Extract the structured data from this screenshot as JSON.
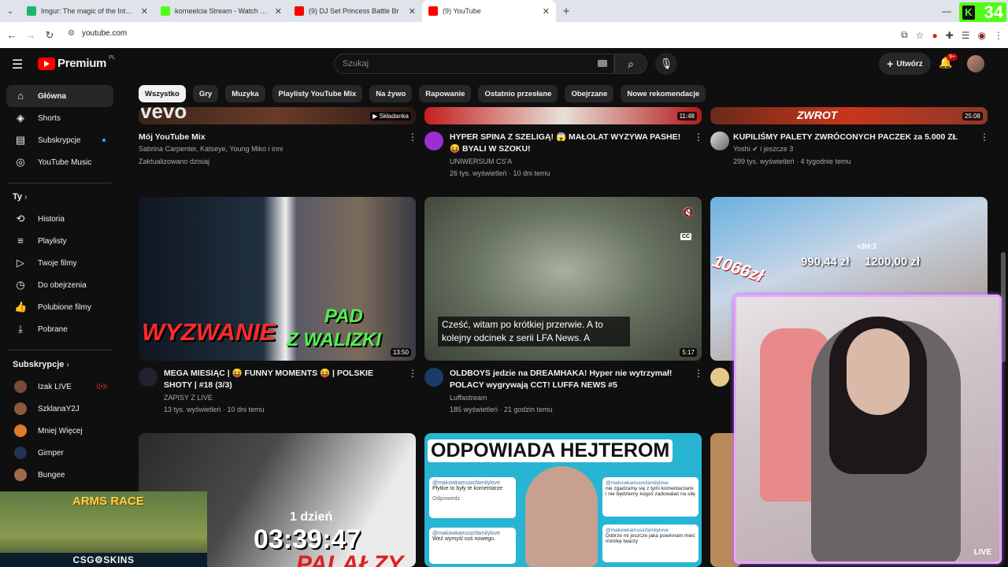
{
  "browser": {
    "tabs": [
      {
        "title": "Imgur: The magic of the Internet",
        "color": "#1bb76e"
      },
      {
        "title": "korneelcia Stream - Watch Live",
        "color": "#53fc18"
      },
      {
        "title": "(9) DJ Set Princess Battle Br",
        "color": "#ff0000",
        "prefix": "(9)"
      },
      {
        "title": "(9) YouTube",
        "color": "#ff0000"
      }
    ],
    "url": "youtube.com",
    "kick_viewers": "34"
  },
  "youtube": {
    "logo": "Premium",
    "region": "PL",
    "search_placeholder": "Szukaj",
    "create_label": "Utwórz",
    "notif_count": "9+"
  },
  "sidebar": {
    "main": [
      {
        "label": "Główna",
        "icon": "home-icon"
      },
      {
        "label": "Shorts",
        "icon": "shorts-icon"
      },
      {
        "label": "Subskrypcje",
        "icon": "subscriptions-icon"
      },
      {
        "label": "YouTube Music",
        "icon": "music-icon"
      }
    ],
    "you_header": "Ty",
    "you": [
      {
        "label": "Historia",
        "icon": "history-icon"
      },
      {
        "label": "Playlisty",
        "icon": "playlists-icon"
      },
      {
        "label": "Twoje filmy",
        "icon": "your-videos-icon"
      },
      {
        "label": "Do obejrzenia",
        "icon": "watch-later-icon"
      },
      {
        "label": "Polubione filmy",
        "icon": "liked-icon"
      },
      {
        "label": "Pobrane",
        "icon": "download-icon"
      }
    ],
    "subs_header": "Subskrypcje",
    "subs": [
      {
        "label": "Izak LIVE",
        "color": "#7a4a3a",
        "live": "((•))"
      },
      {
        "label": "SzklanaY2J",
        "color": "#8a5a3a"
      },
      {
        "label": "Mniej Więcej",
        "color": "#e07b2a"
      },
      {
        "label": "Gimper",
        "color": "#223355"
      },
      {
        "label": "Bungee",
        "color": "#a06a4a"
      }
    ]
  },
  "chips": [
    "Wszystko",
    "Gry",
    "Muzyka",
    "Playlisty YouTube Mix",
    "Na żywo",
    "Rapowanie",
    "Ostatnio przesłane",
    "Obejrzane",
    "Nowe rekomendacje"
  ],
  "videos_row1": [
    {
      "title": "Mój YouTube Mix",
      "line2": "Sabrina Carpenter, Katseye, Young Miko i inni",
      "line3": "Zaktualizowano dzisiaj",
      "badge": "Składanka",
      "thumb_text": "vevo"
    },
    {
      "title": "HYPER SPINA Z SZELIGĄ! 😱 MAŁOLAT WYZYWA PASHE! 😝 BYALI W SZOKU!",
      "channel": "UNIWERSUM CS'A",
      "meta": "26 tys. wyświetleń · 10 dni temu",
      "duration": "11:48"
    },
    {
      "title": "KUPILIŚMY PALETY ZWRÓCONYCH PACZEK za 5.000 ZŁ",
      "channel": "Yoshi ✔ i jeszcze 3",
      "meta": "299 tys. wyświetleń · 4 tygodnie temu",
      "duration": "25:08",
      "thumb_text": "ZWROT"
    }
  ],
  "videos_row2": [
    {
      "title": "MEGA MIESIĄC | 😝 FUNNY MOMENTS 😝 | POLSKIE SHOTY | #18 (3/3)",
      "channel": "ZAPISY Z LIVE",
      "meta": "13 tys. wyświetleń · 10 dni temu",
      "duration": "13:50",
      "thumb_text1": "WYZWANIE",
      "thumb_text2": "PAD",
      "thumb_text3": "Z WALIZKI"
    },
    {
      "title": "OLDBOYS jedzie na DREAMHAKA! Hyper nie wytrzymał! POLACY wygrywają CCT! LUFFA NEWS #5",
      "channel": "Luffastream",
      "meta": "185 wyświetleń · 21 godzin temu",
      "duration": "5:17",
      "caption": "Cześć, witam po krótkiej przerwie. A to kolejny odcinek z serii LFA News. A",
      "cc": "CC"
    },
    {
      "thumb_text1": "990,44 zł",
      "thumb_text2": "1200,00 zł",
      "thumb_text3": "1066zł",
      "thumb_text4": "+3H:3"
    }
  ],
  "videos_row3": [
    {
      "thumb_text1": "1 dzień",
      "thumb_text2": "03:39:47",
      "thumb_text3": "PALAŁZY"
    },
    {
      "thumb_text1": "ODPOWIADA HEJTEROM",
      "comment_user": "@makowkamusicfamilylove",
      "comment1": "Płytkie to były te komentarze",
      "comment2": "Weź wymyśl coś nowego.",
      "comment3": "nie zgadzamy się z tymi komentarzami i nie będziemy kogoś zadowalać na siłę",
      "comment4": "Dobrze mi jeszcze jaka powinnam mieć mimikę twarzy",
      "reply": "Odpowiedz"
    }
  ],
  "overlays": {
    "webcam_live": "LIVE",
    "game_title": "ARMS RACE",
    "game_sponsor": "CSG⚙SKINS"
  }
}
